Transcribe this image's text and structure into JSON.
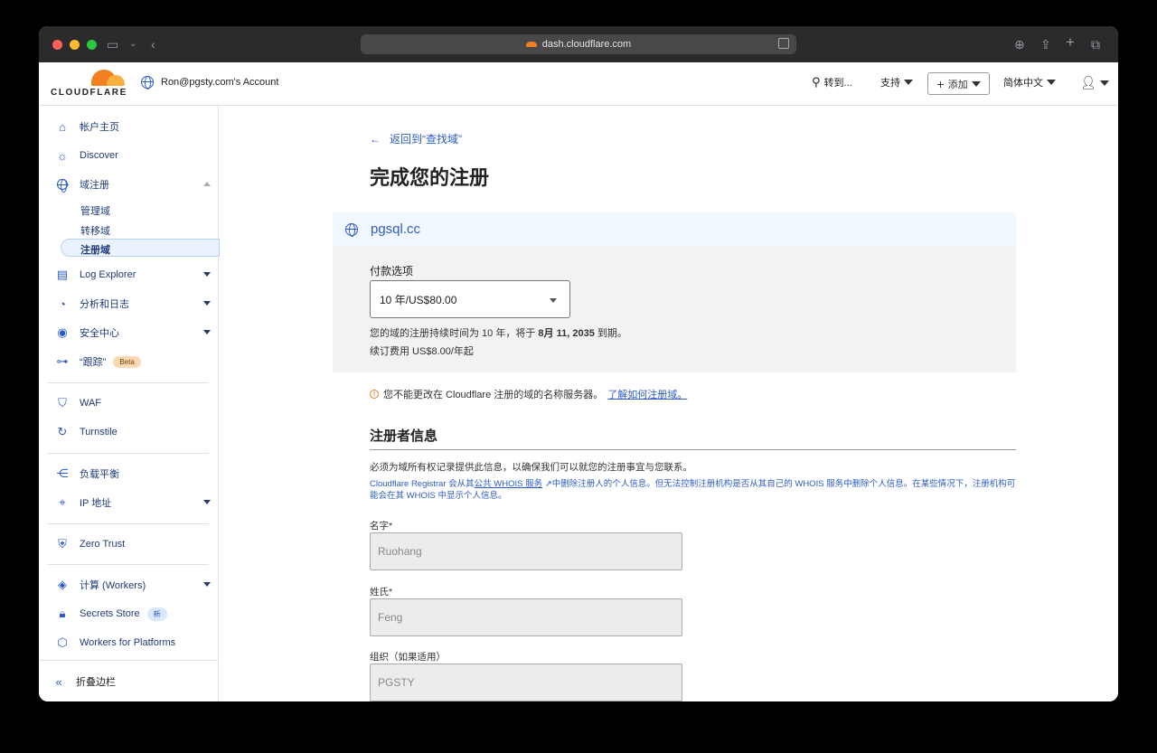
{
  "browser": {
    "url": "dash.cloudflare.com"
  },
  "topnav": {
    "logo_text": "CLOUDFLARE",
    "account": "Ron@pgsty.com's Account",
    "goto": "转到...",
    "support": "支持",
    "add": "添加",
    "language": "简体中文"
  },
  "sidebar": {
    "items": [
      {
        "label": "帐户主页"
      },
      {
        "label": "Discover"
      },
      {
        "label": "域注册"
      },
      {
        "label": "Log Explorer"
      },
      {
        "label": "分析和日志"
      },
      {
        "label": "安全中心"
      },
      {
        "label": "“跟踪”",
        "badge": "Beta"
      },
      {
        "label": "WAF"
      },
      {
        "label": "Turnstile"
      },
      {
        "label": "负载平衡"
      },
      {
        "label": "IP 地址"
      },
      {
        "label": "Zero Trust"
      },
      {
        "label": "计算 (Workers)"
      },
      {
        "label": "Secrets Store",
        "badge": "新"
      },
      {
        "label": "Workers for Platforms"
      }
    ],
    "subitems": [
      "管理域",
      "转移域",
      "注册域"
    ],
    "collapse": "折叠边栏"
  },
  "main": {
    "back": "返回到“查找域”",
    "title": "完成您的注册",
    "domain": "pgsql.cc",
    "payment": {
      "label": "付款选项",
      "selected": "10 年/US$80.00",
      "note1_pre": "您的域的注册持续时间为 10 年，将于",
      "note1_date": "8月 11, 2035",
      "note1_post": "到期。",
      "note2": "续订费用 US$8.00/年起"
    },
    "warning_text": "您不能更改在 Cloudflare 注册的域的名称服务器。",
    "warning_link": "了解如何注册域。",
    "registrant": {
      "title": "注册者信息",
      "desc": "必须为域所有权记录提供此信息，以确保我们可以就您的注册事宜与您联系。",
      "whois_pre": "Cloudflare Registrar 会从其",
      "whois_link": "公共 WHOIS 服务",
      "whois_post": "中删除注册人的个人信息。但无法控制注册机构是否从其自己的 WHOIS 服务中删除个人信息。在某些情况下，注册机构可能会在其 WHOIS 中显示个人信息。",
      "fields": [
        {
          "label": "名字*",
          "value": "Ruohang"
        },
        {
          "label": "姓氏*",
          "value": "Feng"
        },
        {
          "label": "组织（如果适用）",
          "value": "PGSTY"
        }
      ]
    }
  },
  "colors": {
    "accent": "#2c5bc7",
    "brand_orange": "#f38020",
    "warning": "#d9822b"
  }
}
